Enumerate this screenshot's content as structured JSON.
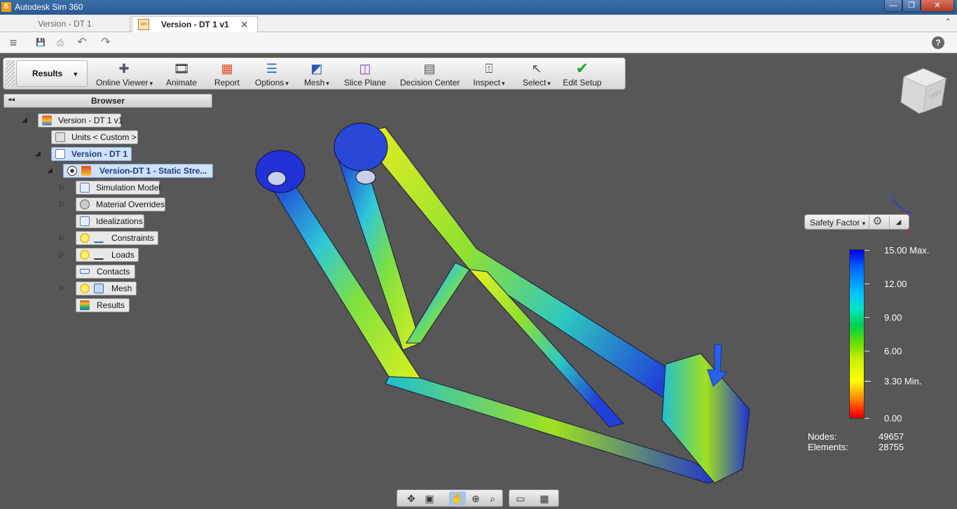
{
  "app": {
    "title": "Autodesk Sim 360",
    "icon": "S"
  },
  "window_controls": {
    "minimize": "—",
    "restore": "❐",
    "close": "✕"
  },
  "tabs": [
    {
      "label": "Version - DT 1"
    },
    {
      "label": "Version - DT 1 v1",
      "icon": "sim",
      "close": "✕"
    }
  ],
  "tabbar_collapse": "⌃",
  "qat": {
    "menu": "≡",
    "save": "💾",
    "undo": "↶",
    "redo": "↷",
    "help": "?"
  },
  "ribbon": {
    "mode": "Results",
    "buttons": [
      {
        "label": "Online Viewer",
        "icon": "online-viewer-icon",
        "glyph": "✚"
      },
      {
        "label": "Animate",
        "icon": "animate-icon",
        "glyph": "🎞"
      },
      {
        "label": "Report",
        "icon": "report-icon",
        "glyph": "▦"
      },
      {
        "label": "Options",
        "icon": "options-icon",
        "glyph": "☰"
      },
      {
        "label": "Mesh",
        "icon": "mesh-icon",
        "glyph": "◩"
      },
      {
        "label": "Slice Plane",
        "icon": "slice-plane-icon",
        "glyph": "◫"
      },
      {
        "label": "Decision Center",
        "icon": "decision-center-icon",
        "glyph": "▤"
      },
      {
        "label": "Inspect",
        "icon": "inspect-icon",
        "glyph": "⍐"
      },
      {
        "label": "Select",
        "icon": "select-icon",
        "glyph": "↖"
      },
      {
        "label": "Edit Setup",
        "icon": "edit-setup-icon",
        "glyph": "✔"
      }
    ]
  },
  "browser": {
    "title": "Browser",
    "collapse": "◂◂",
    "nodes": [
      {
        "label": "Version - DT 1 v1"
      },
      {
        "label": "Units < Custom >"
      },
      {
        "label": "Version - DT 1"
      },
      {
        "label": "Version-DT 1 - Static Stre..."
      },
      {
        "label": "Simulation Model"
      },
      {
        "label": "Material Overrides"
      },
      {
        "label": "Idealizations"
      },
      {
        "label": "Constraints"
      },
      {
        "label": "Loads"
      },
      {
        "label": "Contacts"
      },
      {
        "label": "Mesh"
      },
      {
        "label": "Results"
      }
    ]
  },
  "viewcube": {
    "face": "LEFT"
  },
  "axis": {
    "z": "Z"
  },
  "result_selector": {
    "label": "Safety Factor",
    "dropdown": "▾",
    "gear": "⚙",
    "collapse": "◢"
  },
  "legend": {
    "labels": [
      "15.00 Max.",
      "12.00",
      "9.00",
      "6.00",
      "3.30 Min.",
      "0.00"
    ],
    "max": 15.0,
    "min": 0.0,
    "min_result": 3.3
  },
  "stats": {
    "nodes_label": "Nodes:",
    "nodes": "49657",
    "elements_label": "Elements:",
    "elements": "28755"
  },
  "colors": {
    "accent": "#2a5a92",
    "background": "#575757",
    "selected": "#cfe1fb"
  }
}
